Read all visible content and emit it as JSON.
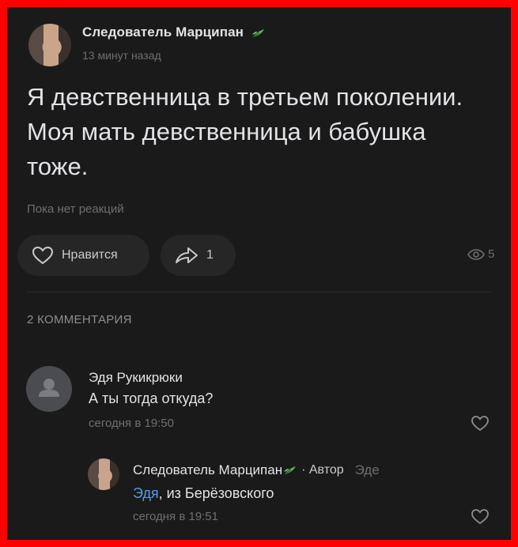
{
  "post": {
    "author_name": "Следователь Марципан",
    "timestamp": "13 минут назад",
    "text": "Я девственница в третьем поколении. Моя мать девственница и бабушка тоже.",
    "reactions_empty": "Пока нет реакций",
    "like_label": "Нравится",
    "share_count": "1",
    "views_count": "5"
  },
  "comments_header": "2 КОММЕНТАРИЯ",
  "comments": [
    {
      "author": "Эдя Рукикрюки",
      "text": "А ты тогда откуда?",
      "time": "сегодня в 19:50"
    },
    {
      "author": "Следователь Марципан",
      "author_badge": "· Автор",
      "reply_action": "Эде",
      "mention": "Эдя",
      "text": ", из Берёзовского",
      "time": "сегодня в 19:51"
    }
  ],
  "colors": {
    "background": "#1a1a1b",
    "frame": "#ff0000",
    "text_primary": "#e1e3e6",
    "text_secondary": "#6d6f73",
    "link": "#5b9ae4",
    "leaf": "#5fb85f"
  }
}
